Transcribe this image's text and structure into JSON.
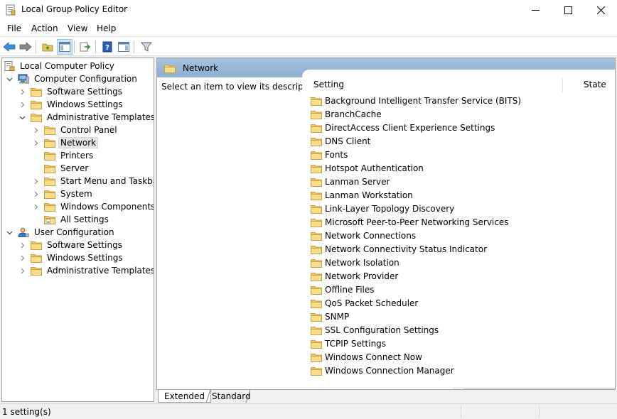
{
  "window": {
    "title": "Local Group Policy Editor"
  },
  "menu": [
    "File",
    "Action",
    "View",
    "Help"
  ],
  "tree": [
    {
      "label": "Local Computer Policy",
      "level": 0,
      "expander": "none",
      "icon": "policy-icon"
    },
    {
      "label": "Computer Configuration",
      "level": 1,
      "expander": "expanded",
      "icon": "computer-icon"
    },
    {
      "label": "Software Settings",
      "level": 2,
      "expander": "collapsed",
      "icon": "folder-icon"
    },
    {
      "label": "Windows Settings",
      "level": 2,
      "expander": "collapsed",
      "icon": "folder-icon"
    },
    {
      "label": "Administrative Templates",
      "level": 2,
      "expander": "expanded",
      "icon": "folder-icon"
    },
    {
      "label": "Control Panel",
      "level": 3,
      "expander": "collapsed",
      "icon": "folder-icon"
    },
    {
      "label": "Network",
      "level": 3,
      "expander": "collapsed",
      "icon": "folder-icon",
      "selected": true
    },
    {
      "label": "Printers",
      "level": 3,
      "expander": "none",
      "icon": "folder-icon"
    },
    {
      "label": "Server",
      "level": 3,
      "expander": "none",
      "icon": "folder-icon"
    },
    {
      "label": "Start Menu and Taskbar",
      "level": 3,
      "expander": "collapsed",
      "icon": "folder-icon"
    },
    {
      "label": "System",
      "level": 3,
      "expander": "collapsed",
      "icon": "folder-icon"
    },
    {
      "label": "Windows Components",
      "level": 3,
      "expander": "collapsed",
      "icon": "folder-icon"
    },
    {
      "label": "All Settings",
      "level": 3,
      "expander": "none",
      "icon": "settings-folder-icon"
    },
    {
      "label": "User Configuration",
      "level": 1,
      "expander": "expanded",
      "icon": "user-icon"
    },
    {
      "label": "Software Settings",
      "level": 2,
      "expander": "collapsed",
      "icon": "folder-icon"
    },
    {
      "label": "Windows Settings",
      "level": 2,
      "expander": "collapsed",
      "icon": "folder-icon"
    },
    {
      "label": "Administrative Templates",
      "level": 2,
      "expander": "collapsed",
      "icon": "folder-icon"
    }
  ],
  "right": {
    "header": "Network",
    "description": "Select an item to view its description.",
    "columns": {
      "setting": "Setting",
      "state": "State"
    },
    "items": [
      "Background Intelligent Transfer Service (BITS)",
      "BranchCache",
      "DirectAccess Client Experience Settings",
      "DNS Client",
      "Fonts",
      "Hotspot Authentication",
      "Lanman Server",
      "Lanman Workstation",
      "Link-Layer Topology Discovery",
      "Microsoft Peer-to-Peer Networking Services",
      "Network Connections",
      "Network Connectivity Status Indicator",
      "Network Isolation",
      "Network Provider",
      "Offline Files",
      "QoS Packet Scheduler",
      "SNMP",
      "SSL Configuration Settings",
      "TCPIP Settings",
      "Windows Connect Now",
      "Windows Connection Manager"
    ]
  },
  "tabs": {
    "extended": "Extended",
    "standard": "Standard"
  },
  "status": {
    "text": "1 setting(s)"
  },
  "colors": {
    "header_blue": "#8fb3d6",
    "folder_yellow": "#f3d27a",
    "selection": "#e5e5e5"
  }
}
